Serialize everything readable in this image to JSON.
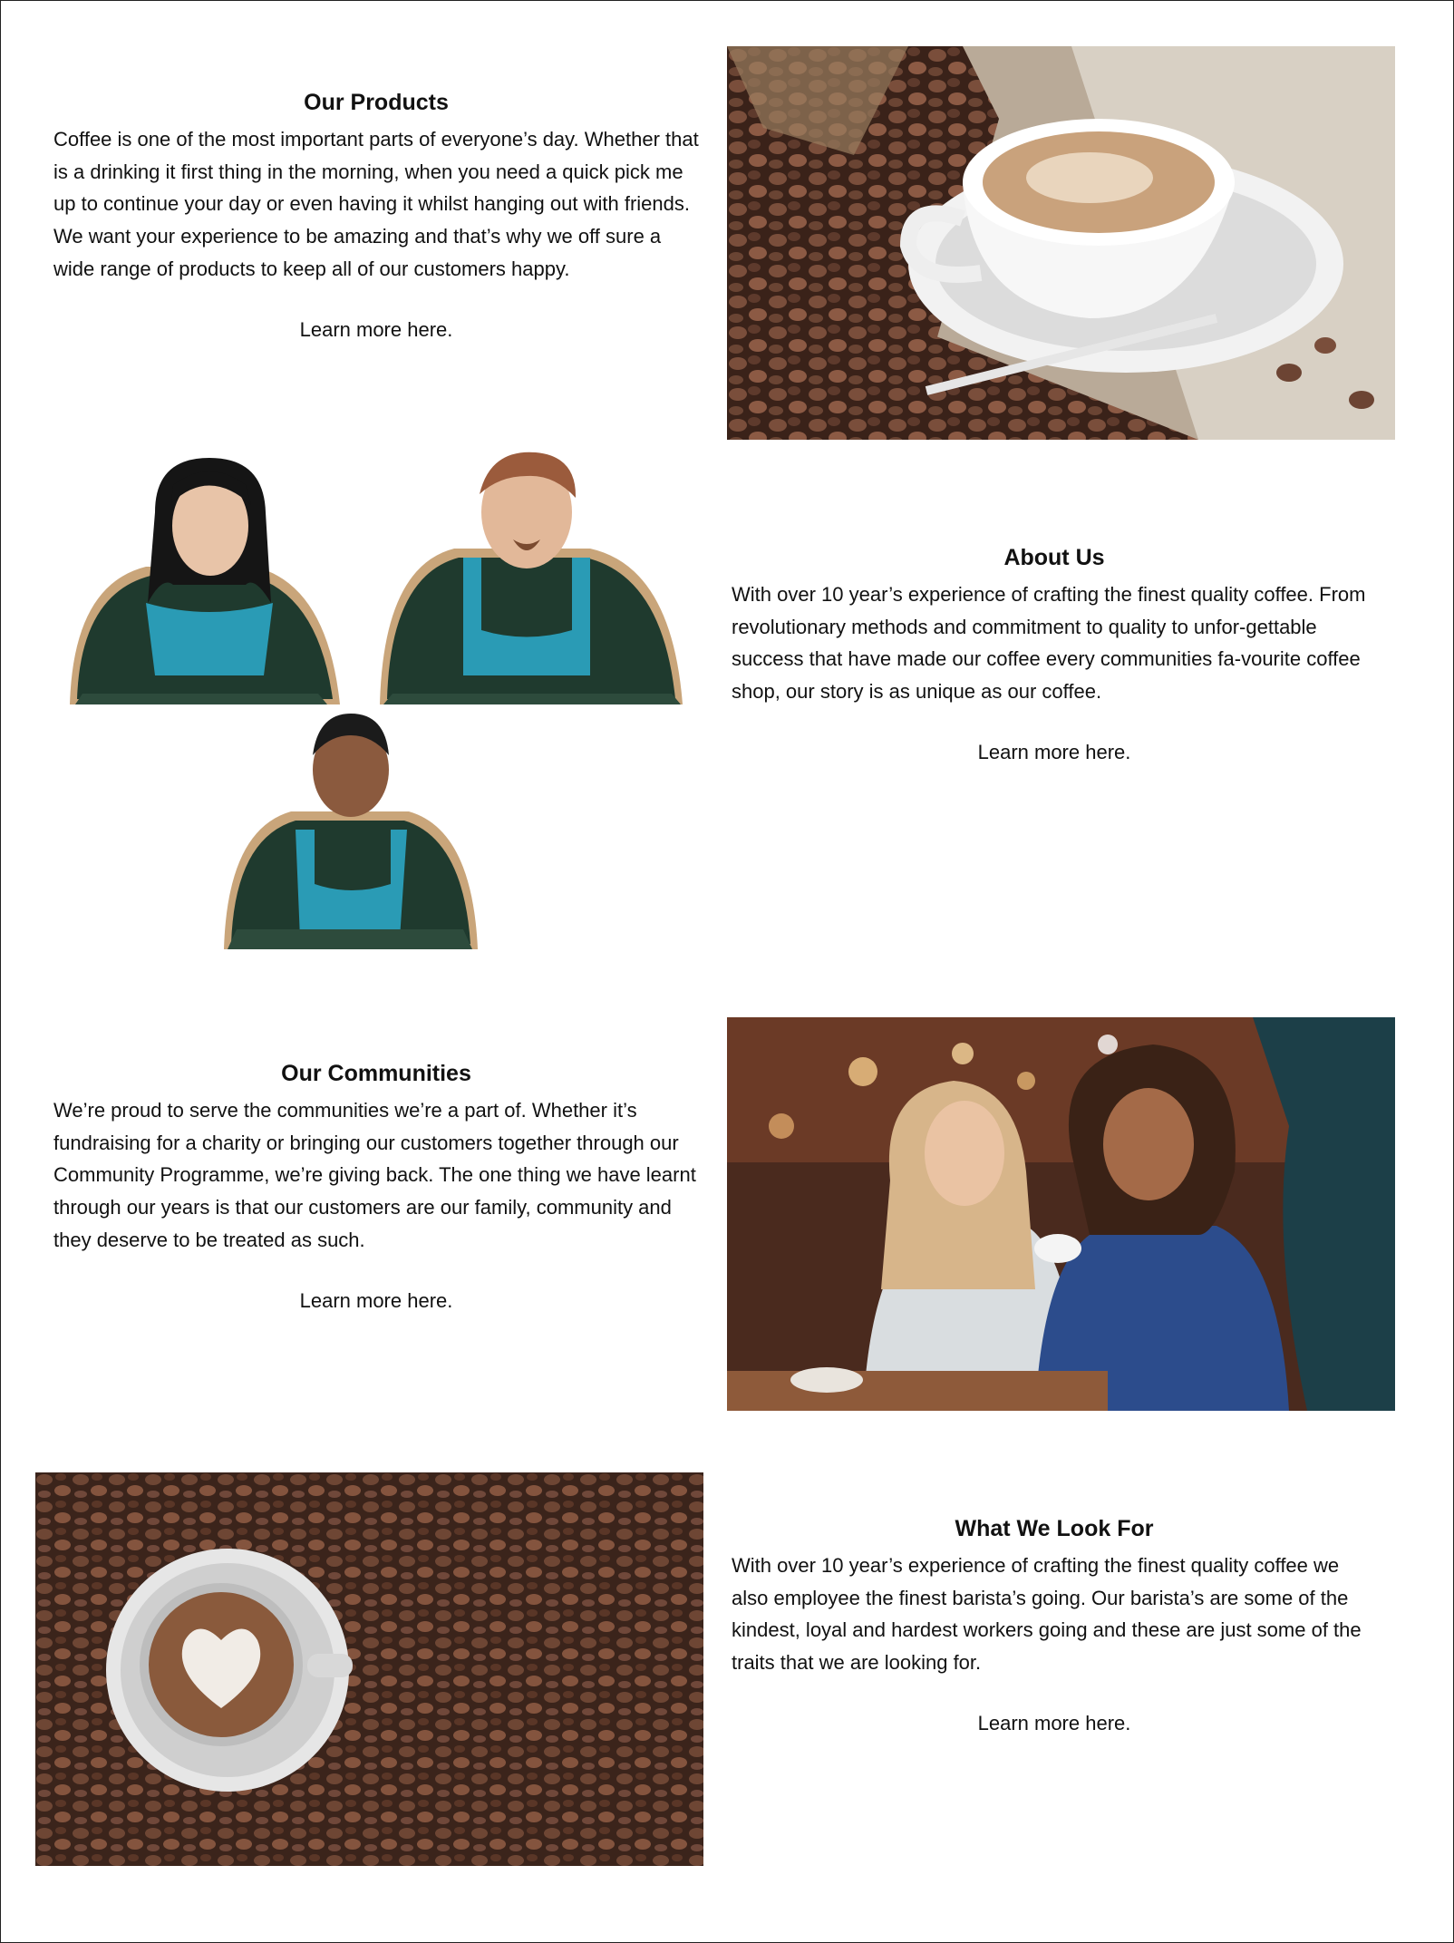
{
  "sections": [
    {
      "title": "Our Products",
      "body": "Coffee is one of the most important parts of everyone’s day. Whether that is a drinking it first thing in the morning, when you need a quick pick me up to continue your day or even having it whilst hanging out with friends. We want your experience to be amazing and that’s why we off sure a wide range of products to keep all of our customers happy.",
      "link": "Learn more here."
    },
    {
      "title": "About Us",
      "body": "With over 10 year’s experience of crafting the finest quality coffee. From revolutionary methods and commitment to quality to unfor-gettable success that have made our coffee every communities fa-vourite coffee shop, our story is as unique as our coffee.",
      "link": "Learn more here."
    },
    {
      "title": "Our Communities",
      "body": "We’re proud to serve the communities we’re a part of. Whether it’s fundraising for a charity or bringing our customers together through our Community Programme, we’re giving back. The one thing we have learnt through our years is that our customers are our family, community and they deserve to be treated as such.",
      "link": "Learn more here."
    },
    {
      "title": "What We Look For",
      "body": "With over 10 year’s experience of crafting the finest quality coffee we also employee the finest barista’s going. Our barista’s are some of the kindest, loyal and hardest workers going and these are just some of the traits that we are looking for.",
      "link": "Learn more here."
    }
  ],
  "images": {
    "products": "coffee-cup-with-beans",
    "team": "three-barista-illustrations",
    "communities": "two-women-in-cafe",
    "look_for": "latte-heart-on-coffee-beans"
  },
  "colors": {
    "bean_dark": "#3b241b",
    "bean_mid": "#6e4634",
    "apron_blue": "#2a9bb5",
    "shirt_green": "#1f3a2e"
  }
}
